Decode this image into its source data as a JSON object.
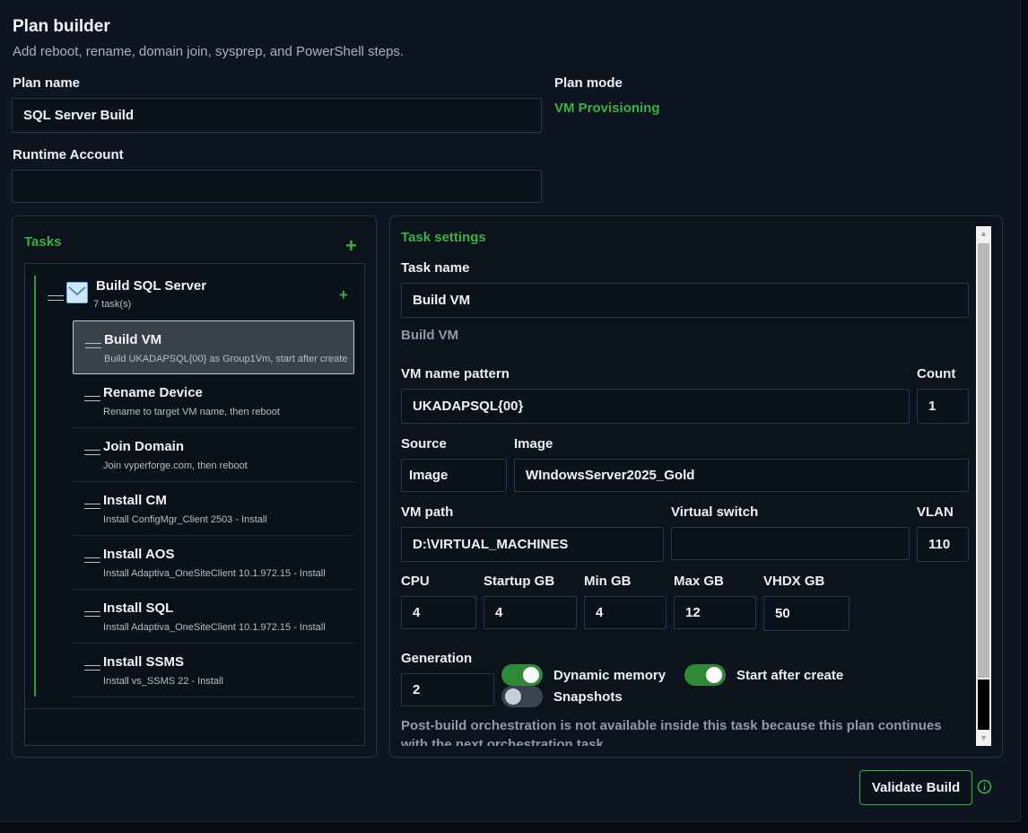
{
  "header": {
    "title": "Plan builder",
    "subtitle": "Add reboot, rename, domain join, sysprep, and PowerShell steps."
  },
  "plan": {
    "name_label": "Plan name",
    "name_value": "SQL Server Build",
    "mode_label": "Plan mode",
    "mode_value": "VM Provisioning",
    "runtime_label": "Runtime Account",
    "runtime_value": ""
  },
  "tasks_panel": {
    "title": "Tasks",
    "group": {
      "name": "Build SQL Server",
      "count": "7 task(s)"
    },
    "items": [
      {
        "name": "Build VM",
        "desc": "Build UKADAPSQL{00} as Group1Vm, start after create"
      },
      {
        "name": "Rename Device",
        "desc": "Rename to target VM name, then reboot"
      },
      {
        "name": "Join Domain",
        "desc": "Join vyperforge.com, then reboot"
      },
      {
        "name": "Install CM",
        "desc": "Install ConfigMgr_Client 2503 - Install"
      },
      {
        "name": "Install AOS",
        "desc": "Install Adaptiva_OneSiteClient 10.1.972.15 - Install"
      },
      {
        "name": "Install SQL",
        "desc": "Install Adaptiva_OneSiteClient 10.1.972.15 - Install"
      },
      {
        "name": "Install SSMS",
        "desc": "Install vs_SSMS 22 - Install"
      }
    ]
  },
  "settings": {
    "title": "Task settings",
    "task_name_label": "Task name",
    "task_name_value": "Build VM",
    "task_type": "Build VM",
    "vm_name_pattern_label": "VM name pattern",
    "vm_name_pattern_value": "UKADAPSQL{00}",
    "count_label": "Count",
    "count_value": "1",
    "source_label": "Source",
    "source_value": "Image",
    "image_label": "Image",
    "image_value": "WIndowsServer2025_Gold",
    "vm_path_label": "VM path",
    "vm_path_value": "D:\\VIRTUAL_MACHINES",
    "virtual_switch_label": "Virtual switch",
    "virtual_switch_value": "",
    "vlan_label": "VLAN",
    "vlan_value": "110",
    "cpu_label": "CPU",
    "cpu_value": "4",
    "startup_gb_label": "Startup GB",
    "startup_gb_value": "4",
    "min_gb_label": "Min GB",
    "min_gb_value": "4",
    "max_gb_label": "Max GB",
    "max_gb_value": "12",
    "vhdx_gb_label": "VHDX GB",
    "vhdx_gb_value": "50",
    "generation_label": "Generation",
    "generation_value": "2",
    "dynamic_memory_label": "Dynamic memory",
    "dynamic_memory_on": true,
    "start_after_create_label": "Start after create",
    "start_after_create_on": true,
    "snapshots_label": "Snapshots",
    "snapshots_on": false,
    "note": "Post-build orchestration is not available inside this task because this plan continues with the next orchestration task."
  },
  "footer": {
    "validate_label": "Validate Build",
    "info_icon": "info-circle-icon"
  },
  "colors": {
    "accent": "#3cb043",
    "background": "#0e1520",
    "panel": "#0c131d",
    "border": "#2a3542"
  }
}
